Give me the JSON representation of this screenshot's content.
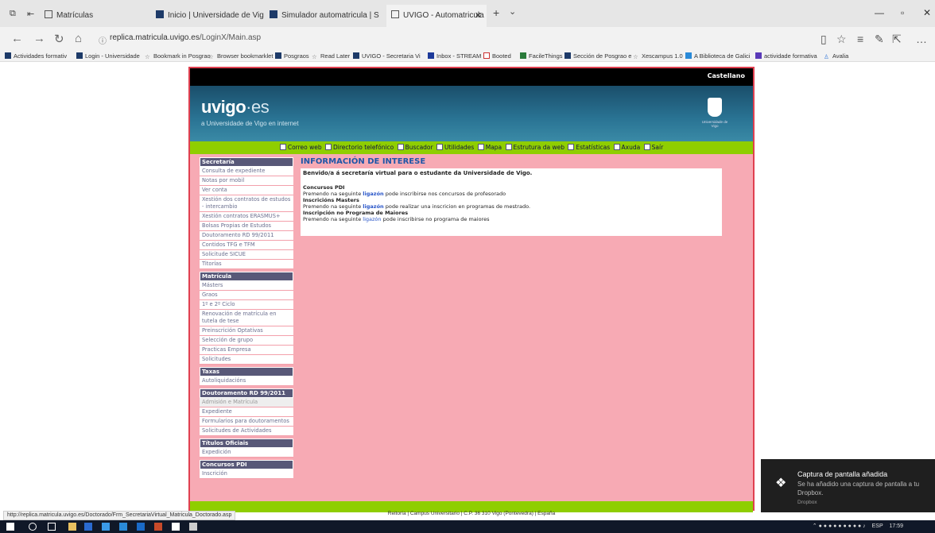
{
  "tabs": [
    {
      "label": "Matrículas",
      "active": false
    },
    {
      "label": "Inicio | Universidade de Vig",
      "active": false
    },
    {
      "label": "Simulador automatricula | S",
      "active": false
    },
    {
      "label": "UVIGO - Automatricula",
      "active": true
    }
  ],
  "address": {
    "host": "replica.matricula.uvigo.es",
    "path": "/LoginX/Main.asp"
  },
  "favorites": [
    "Actividades formativ",
    "Login - Universidade",
    "Bookmark in Posgrao",
    "Browser bookmarklet",
    "Posgraos",
    "Read Later",
    "UVIGO - Secretaria Vi",
    "Inbox - STREAM",
    "Booted",
    "FacileThings",
    "Sección de Posgrao e",
    "Xescampus 1.0",
    "A Biblioteca de Galici",
    "actividade formativa",
    "Avalia"
  ],
  "site": {
    "lang": "Castellano",
    "logo_main": "uvigo",
    "logo_tld": "es",
    "tagline": "a Universidade de Vigo en internet",
    "crest_caption": "Universidade de Vigo",
    "topnav": [
      "Correo web",
      "Directorio telefónico",
      "Buscador",
      "Utilidades",
      "Mapa",
      "Estrutura da web",
      "Estatísticas",
      "Axuda",
      "Saír"
    ]
  },
  "sidebar": [
    {
      "title": "Secretaría",
      "items": [
        "Consulta de expediente",
        "Notas por mobil",
        "Ver conta",
        "Xestión dos contratos de estudos - intercambio",
        "Xestión contratos ERASMUS+",
        "Bolsas Propias de Estudos",
        "Doutoramento RD 99/2011",
        "Contidos TFG e TFM",
        "Solicitude SICUE",
        "Titorías"
      ]
    },
    {
      "title": "Matrícula",
      "items": [
        "Másters",
        "Graos",
        "1º e 2º Ciclo",
        "Renovación de matrícula en tutela de tese",
        "Preinscrición Optativas",
        "Selección de grupo",
        "Practicas Empresa",
        "Solicitudes"
      ]
    },
    {
      "title": "Taxas",
      "items": [
        "Autoliquidacións"
      ]
    },
    {
      "title": "Doutoramento RD 99/2011",
      "items": [
        "Admisión e Matrícula",
        "Expediente",
        "Formularios para doutoramentos",
        "Solicitudes de Actividades"
      ]
    },
    {
      "title": "Títulos Oficiais",
      "items": [
        "Expedición"
      ]
    },
    {
      "title": "Concursos PDI",
      "items": [
        "Inscrición"
      ]
    }
  ],
  "main": {
    "title": "INFORMACIÓN DE INTERESE",
    "welcome": "Benvido/a á secretaría virtual para o estudante da Universidade de Vigo.",
    "sections": [
      {
        "heading": "Concursos PDI",
        "pre": "Premendo na seguinte ",
        "link": "ligazón",
        "post": " pode inscribirse nos concursos de profesorado"
      },
      {
        "heading": "Inscricións Masters",
        "pre": "Premendo na seguinte ",
        "link": "ligazón",
        "post": " pode realizar una inscricion en programas de mestrado."
      },
      {
        "heading": "Inscripción no Programa de Maiores",
        "pre": "Premendo na seguinte ",
        "link": "ligazón",
        "post": " pode inscribirse no programa de maiores"
      }
    ]
  },
  "footer": "Reitoría | Campus Universitario | C.P. 36 310 Vigo (Pontevedra) | España",
  "status_url": "http://replica.matricula.uvigo.es/Doctorado/Frm_SecretariaVirtual_Matricula_Doctorado.asp",
  "toast": {
    "title": "Captura de pantalla añadida",
    "body": "Se ha añadido una captura de pantalla a tu Dropbox.",
    "source": "Dropbox"
  },
  "clock": {
    "lang": "ESP",
    "time": "17:59"
  }
}
